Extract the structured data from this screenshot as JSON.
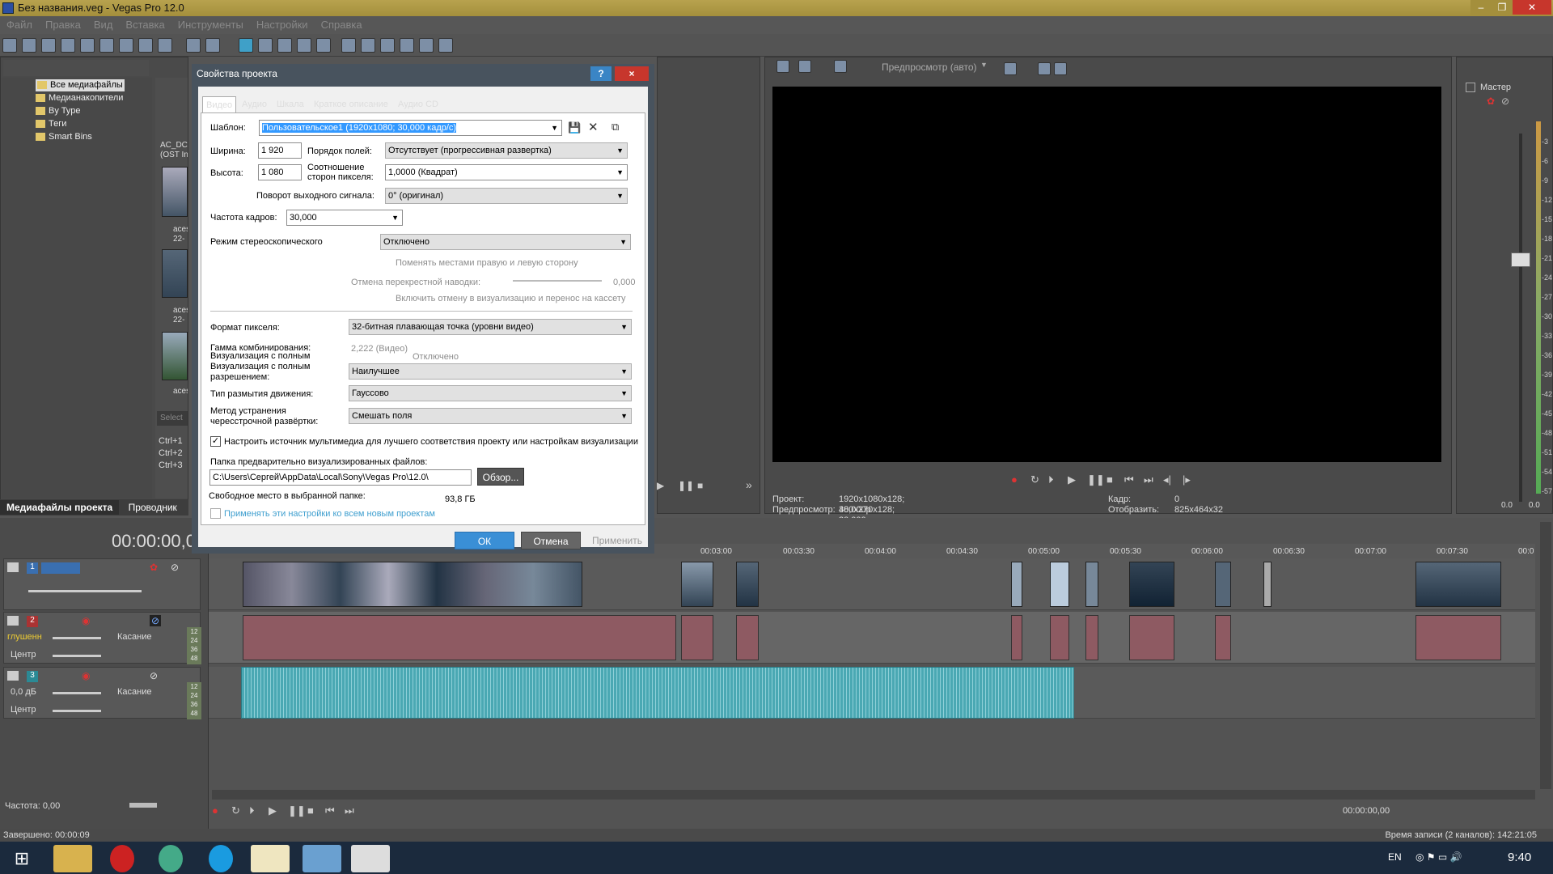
{
  "window": {
    "title": "Без названия.veg - Vegas Pro 12.0"
  },
  "menu": [
    "Файл",
    "Правка",
    "Вид",
    "Вставка",
    "Инструменты",
    "Настройки",
    "Справка"
  ],
  "explorer": {
    "tree": [
      "Все медиафайлы",
      "Медианакопители",
      "By Type",
      "Теги",
      "Smart Bins"
    ],
    "clip_label": "AC_DC\n(OST In",
    "thumb_labels": [
      "aces\n22-",
      "aces\n22-",
      "aces"
    ],
    "search_placeholder": "Select",
    "shortcuts": [
      "Ctrl+1",
      "Ctrl+2",
      "Ctrl+3"
    ],
    "tabs": [
      "Медиафайлы проекта",
      "Проводник"
    ]
  },
  "preview": {
    "mode": "Предпросмотр (авто)",
    "project_label": "Проект:",
    "project_value": "1920x1080x128; 30,000p",
    "preview_label": "Предпросмотр:",
    "preview_value": "480x270x128; 30,000p",
    "frame_label": "Кадр:",
    "frame_value": "0",
    "display_label": "Отобразить:",
    "display_value": "825x464x32"
  },
  "mixer": {
    "title": "Мастер",
    "scale": [
      "-3",
      "-6",
      "-9",
      "-12",
      "-15",
      "-18",
      "-21",
      "-24",
      "-27",
      "-30",
      "-33",
      "-36",
      "-39",
      "-42",
      "-45",
      "-48",
      "-51",
      "-54",
      "-57"
    ],
    "bottom": [
      "0.0",
      "0.0"
    ]
  },
  "timeline": {
    "time": "00:00:00,0",
    "ruler": [
      "00:03:00",
      "00:03:30",
      "00:04:00",
      "00:04:30",
      "00:05:00",
      "00:05:30",
      "00:06:00",
      "00:06:30",
      "00:07:00",
      "00:07:30",
      "00:0"
    ],
    "tracks": [
      {
        "num": "1"
      },
      {
        "num": "2",
        "vol": "глушенн",
        "pan": "Центр",
        "touch": "Касание"
      },
      {
        "num": "3",
        "vol": "0,0 дБ",
        "pan": "Центр",
        "touch": "Касание"
      }
    ],
    "meter": [
      "12",
      "24",
      "36",
      "48"
    ],
    "rate": "Частота: 0,00",
    "end_time": "00:00:00,00"
  },
  "status": {
    "left": "Завершено: 00:00:09",
    "right": "Время записи (2 каналов): 142:21:05"
  },
  "taskbar": {
    "lang": "EN",
    "clock": "9:40"
  },
  "dialog": {
    "title": "Свойства проекта",
    "tabs": [
      "Видео",
      "Аудио",
      "Шкала",
      "Краткое описание",
      "Аудио CD"
    ],
    "template_label": "Шаблон:",
    "template_value": "Пользовательское1 (1920x1080; 30,000 кадр/с)",
    "width_label": "Ширина:",
    "width_value": "1 920",
    "height_label": "Высота:",
    "height_value": "1 080",
    "field_order_label": "Порядок полей:",
    "field_order_value": "Отсутствует (прогрессивная развертка)",
    "pixel_aspect_label": "Соотношение\nсторон пикселя:",
    "pixel_aspect_value": "1,0000 (Квадрат)",
    "rotation_label": "Поворот выходного сигнала:",
    "rotation_value": "0° (оригинал)",
    "frame_rate_label": "Частота кадров:",
    "frame_rate_value": "30,000",
    "stereo_label": "Режим стереоскопического",
    "stereo_value": "Отключено",
    "swap_label": "Поменять местами правую и левую сторону",
    "crosstalk_label": "Отмена перекрестной наводки:",
    "crosstalk_value": "0,000",
    "cancel_render_label": "Включить отмену в визуализацию и перенос на кассету",
    "pixel_format_label": "Формат пикселя:",
    "pixel_format_value": "32-битная плавающая точка (уровни видео)",
    "gamma_label": "Гамма комбинирования:",
    "gamma_value": "2,222 (Видео)",
    "full_res_label_1": "Визуализация с полным",
    "full_res_hidden_value": "Отключено",
    "full_res_label": "Визуализация с полным\nразрешением:",
    "full_res_value": "Наилучшее",
    "motion_blur_label": "Тип размытия движения:",
    "motion_blur_value": "Гауссово",
    "deinterlace_label": "Метод устранения\nчересстрочной развёртки:",
    "deinterlace_value": "Смешать поля",
    "adjust_source_label": "Настроить источник мультимедиа для лучшего соответствия проекту или настройкам визуализации",
    "adjust_source_checked": true,
    "prerender_label": "Папка предварительно визуализированных файлов:",
    "prerender_value": "C:\\Users\\Сергей\\AppData\\Local\\Sony\\Vegas Pro\\12.0\\",
    "browse_label": "Обзор...",
    "free_space_label": "Свободное место в выбранной папке:",
    "free_space_value": "93,8 ГБ",
    "apply_all_label": "Применять эти настройки ко всем новым проектам",
    "ok_label": "ОК",
    "cancel_label": "Отмена",
    "apply_label": "Применить",
    "help_label": "?",
    "close_label": "×"
  }
}
